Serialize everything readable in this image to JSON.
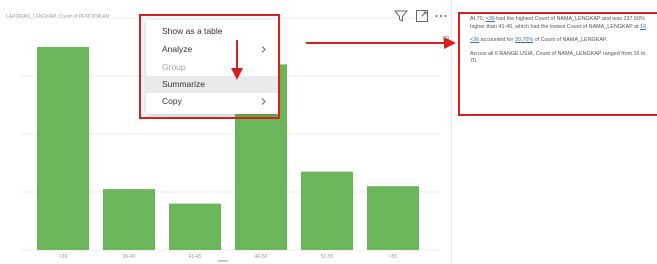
{
  "chart_data": {
    "type": "bar",
    "title": "LAPORAN_LENGKAP, Count of PENDIDIKAN",
    "categories": [
      "<36",
      "36-40",
      "41-45",
      "46-50",
      "51-55",
      ">55"
    ],
    "values": [
      70,
      21,
      16,
      64,
      27,
      22
    ],
    "ylim": [
      0,
      80
    ],
    "color": "#6bb65a",
    "grid": true,
    "legend": "none"
  },
  "context_menu": {
    "items": [
      {
        "label": "Show as a table",
        "submenu": false,
        "disabled": false,
        "highlight": false
      },
      {
        "label": "Analyze",
        "submenu": true,
        "disabled": false,
        "highlight": false
      },
      {
        "label": "Group",
        "submenu": false,
        "disabled": true,
        "highlight": false
      },
      {
        "label": "Summarize",
        "submenu": false,
        "disabled": false,
        "highlight": true
      },
      {
        "label": "Copy",
        "submenu": true,
        "disabled": false,
        "highlight": false
      }
    ]
  },
  "summary": {
    "p1_pre": "At 70, ",
    "p1_link1": "<36",
    "p1_mid": " had the highest Count of NAMA_LENGKAP and was 337.50% higher than 41-45, which had the lowest Count of NAMA_LENGKAP at ",
    "p1_link2": "16",
    "p1_end": ".",
    "p2_link": "<36",
    "p2_mid": " accounted for ",
    "p2_pct": "30.70%",
    "p2_end": " of Count of NAMA_LENGKAP.",
    "p3": "Across all 6 RANGE USIA, Count of NAMA_LENGKAP ranged from 16 to 70."
  },
  "icons": {
    "filter": "filter-icon",
    "focus": "focus-mode-icon",
    "more": "more-options-icon"
  },
  "annotation_color": "#d81e1e"
}
